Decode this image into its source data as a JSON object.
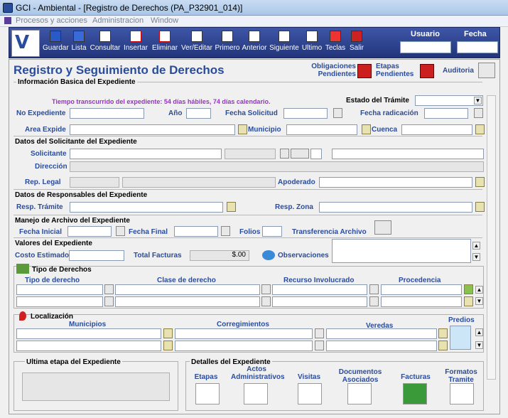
{
  "window": {
    "title": "GCI - Ambiental - [Registro de Derechos  (PA_P32901_014)]"
  },
  "menu": [
    "Procesos y acciones",
    "Administracion",
    "Window"
  ],
  "toolbar": {
    "buttons": [
      "Guardar",
      "Lista",
      "Consultar",
      "Insertar",
      "Eliminar",
      "Ver/Editar",
      "Primero",
      "Anterior",
      "Siguiente",
      "Ultimo",
      "Teclas",
      "Salir"
    ],
    "usuario_label": "Usuario",
    "fecha_label": "Fecha"
  },
  "header": {
    "title": "Registro y Seguimiento de Derechos",
    "obligaciones": "Obligaciones Pendientes",
    "etapas": "Etapas Pendientes",
    "auditoria": "Auditoria"
  },
  "basic": {
    "section": "Información Basica del Expediente",
    "elapsed": "Tiempo transcurrido del expediente: 54 días hábiles, 74 días calendario.",
    "estado_label": "Estado del Trámite",
    "no_expediente": "No Expediente",
    "anio": "Año",
    "fecha_solicitud": "Fecha Solicitud",
    "fecha_radicacion": "Fecha radicación",
    "area_expide": "Area Expide",
    "municipio": "Municipio",
    "cuenca": "Cuenca"
  },
  "solicitante": {
    "section": "Datos del Solicitante del Expediente",
    "solicitante": "Solicitante",
    "direccion": "Dirección",
    "rep_legal": "Rep. Legal",
    "apoderado": "Apoderado"
  },
  "responsables": {
    "section": "Datos de Responsables del Expediente",
    "resp_tramite": "Resp. Trámite",
    "resp_zona": "Resp. Zona"
  },
  "archivo": {
    "section": "Manejo de Archivo del Expediente",
    "fecha_inicial": "Fecha Inicial",
    "fecha_final": "Fecha Final",
    "folios": "Folios",
    "transferencia": "Transferencia Archivo"
  },
  "valores": {
    "section": "Valores del Expediente",
    "costo": "Costo Estimado",
    "total_facturas": "Total Facturas",
    "total_value": "$.00",
    "observaciones": "Observaciones"
  },
  "derechos": {
    "section": "Tipo de Derechos",
    "cols": [
      "Tipo de derecho",
      "Clase de derecho",
      "Recurso Involucrado",
      "Procedencia"
    ]
  },
  "localizacion": {
    "section": "Localización",
    "cols": [
      "Municipios",
      "Corregimientos",
      "Veredas",
      "Predios"
    ]
  },
  "footer": {
    "ultima_etapa": "Ultima etapa del Expediente",
    "detalles": "Detalles del Expediente",
    "items": [
      "Etapas",
      "Actos Administrativos",
      "Visitas",
      "Documentos Asociados",
      "Facturas",
      "Formatos Tramite"
    ]
  }
}
